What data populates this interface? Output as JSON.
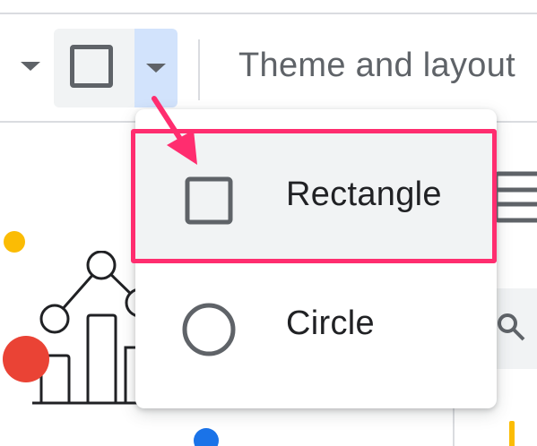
{
  "toolbar": {
    "theme_label": "Theme and layout"
  },
  "shape_menu": {
    "items": [
      {
        "label": "Rectangle",
        "icon": "rectangle-icon",
        "highlighted": true
      },
      {
        "label": "Circle",
        "icon": "circle-icon",
        "highlighted": false
      }
    ]
  },
  "colors": {
    "annotation": "#ff2d6f",
    "icon_gray": "#5f6368",
    "selected_bg": "#d2e3fc",
    "hover_bg": "#f1f3f4"
  }
}
